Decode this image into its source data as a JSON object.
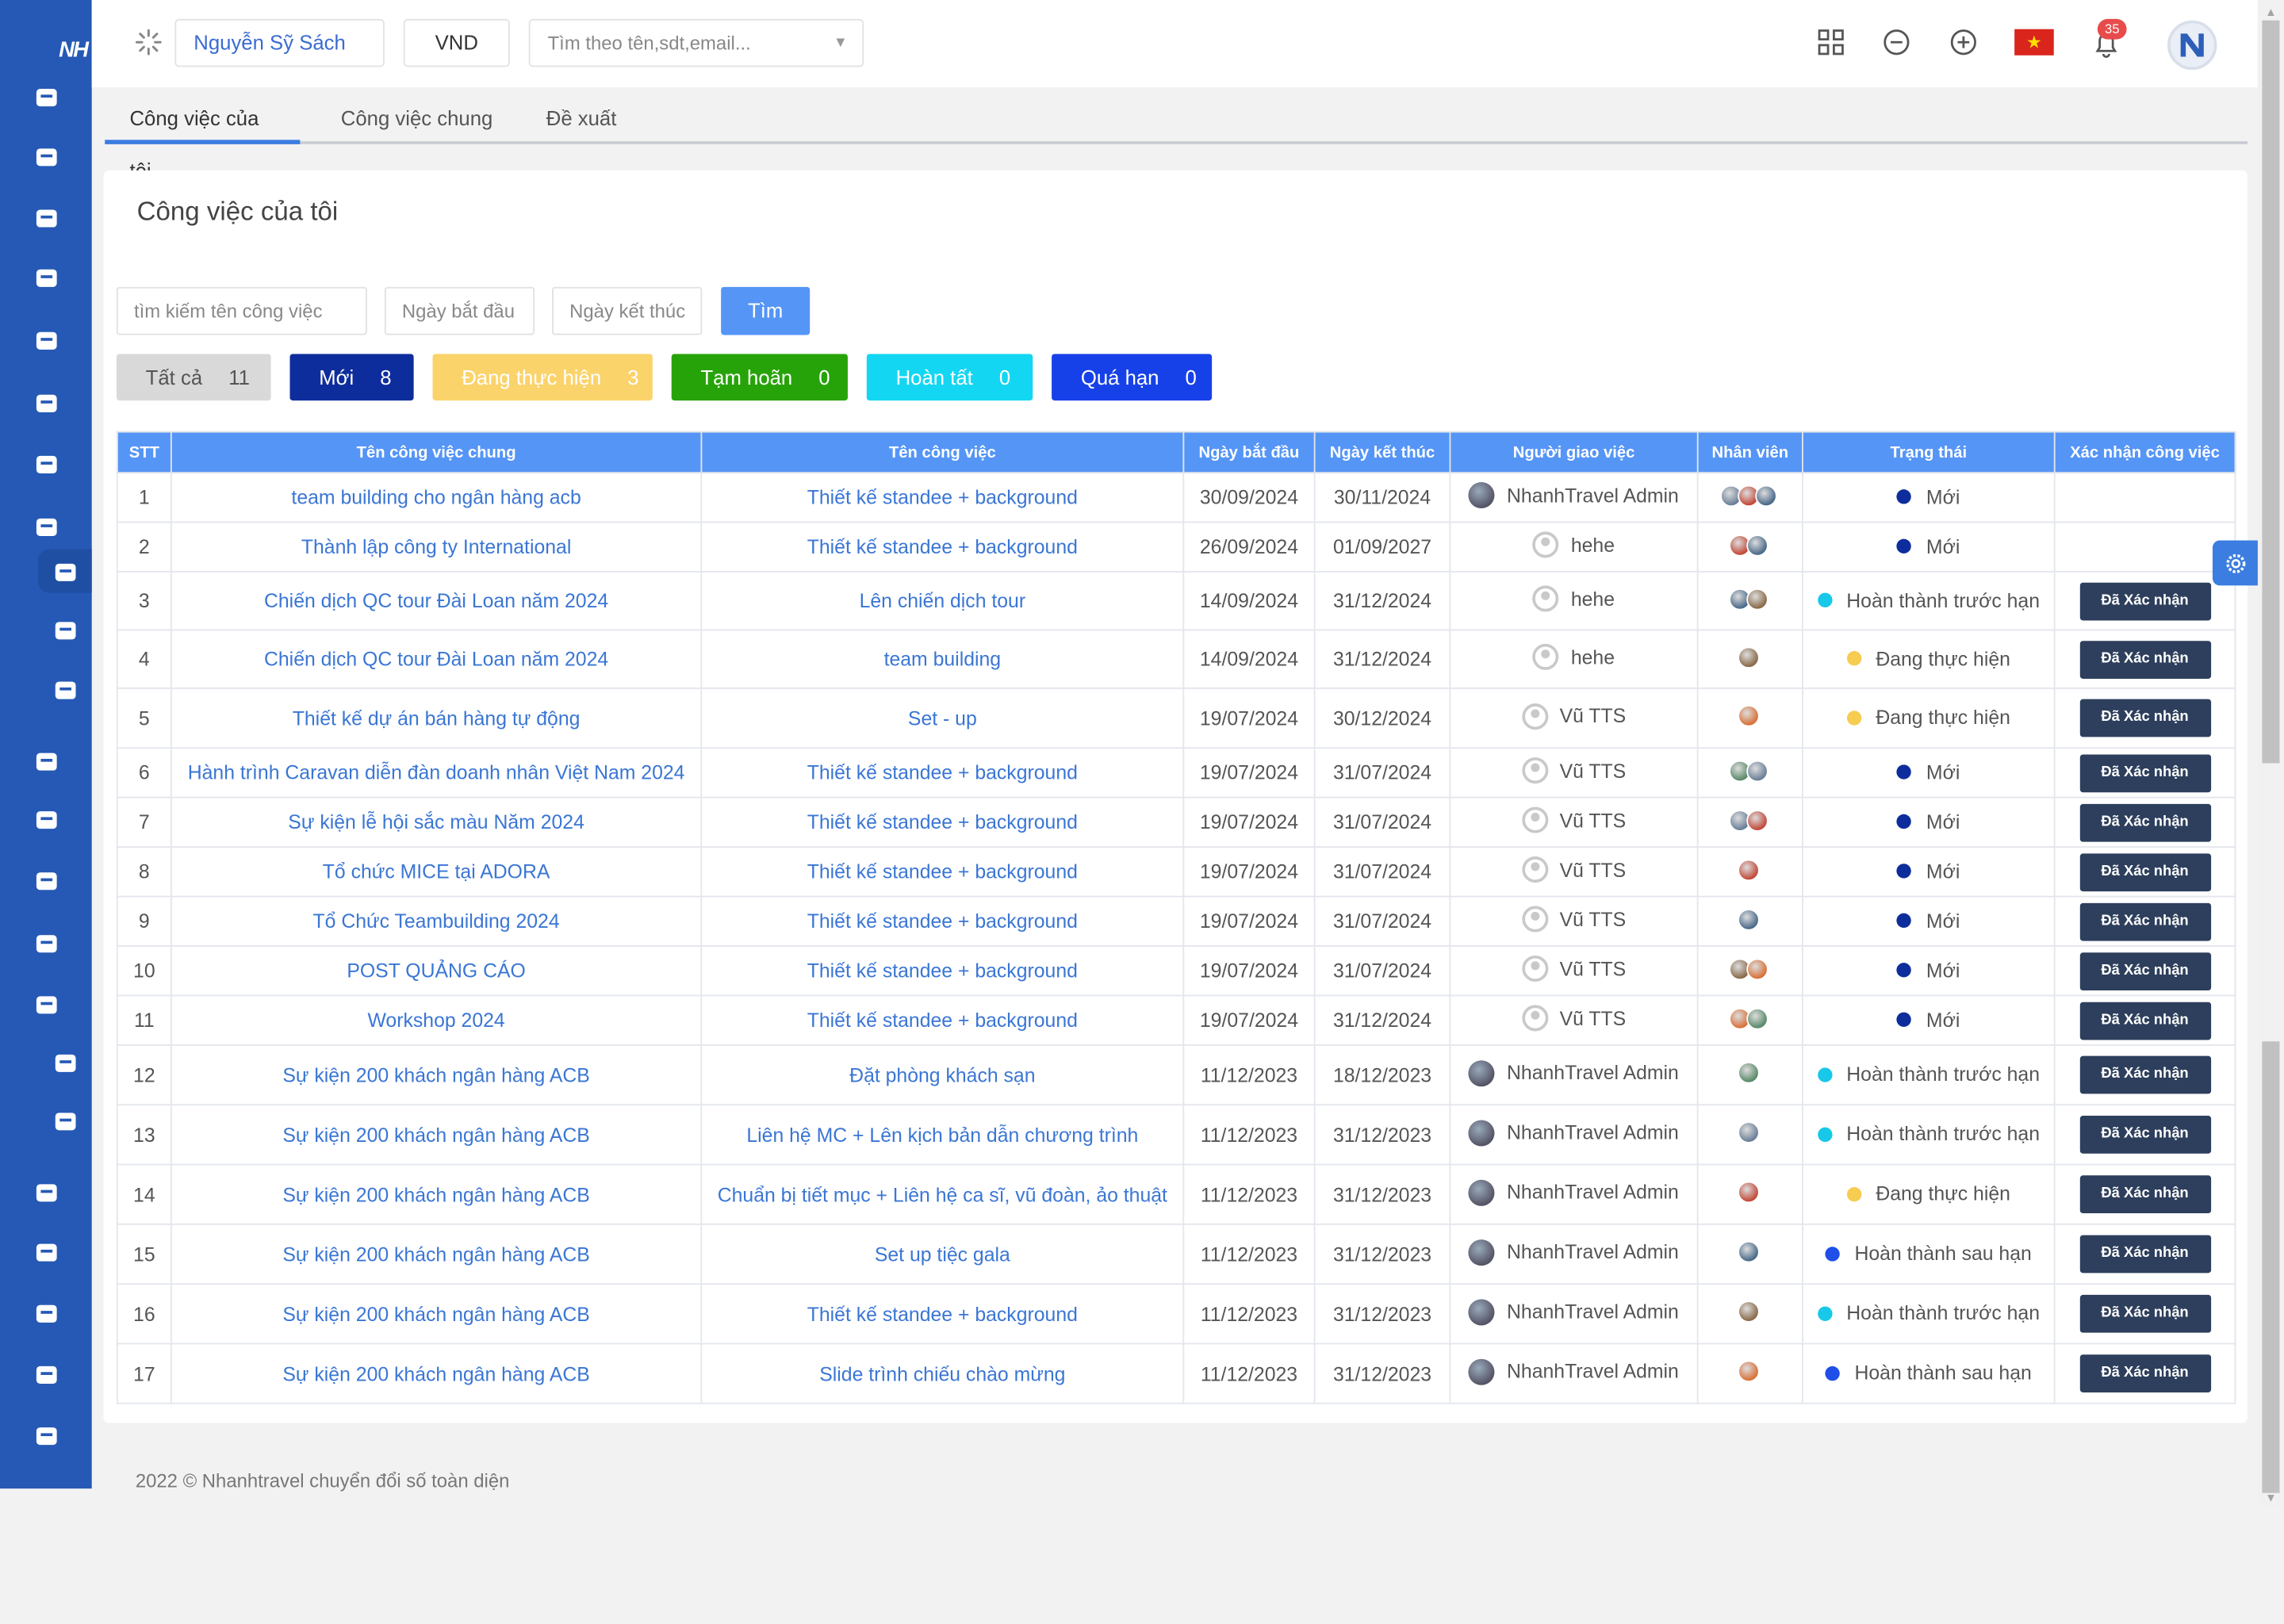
{
  "topbar": {
    "user": "Nguyễn Sỹ Sách",
    "currency": "VND",
    "search_placeholder": "Tìm theo tên,sdt,email...",
    "notification_count": "35"
  },
  "sidebar": {
    "logo": "NH"
  },
  "tabs": [
    "Công việc của tôi",
    "Công việc chung",
    "Đề xuất"
  ],
  "page": {
    "title": "Công việc của tôi",
    "filters": {
      "task_name": "tìm kiếm tên công việc",
      "start_date": "Ngày bắt đầu",
      "end_date": "Ngày kết thúc",
      "find": "Tìm"
    },
    "status_pills": [
      {
        "label": "Tất cả",
        "count": "11"
      },
      {
        "label": "Mới",
        "count": "8"
      },
      {
        "label": "Đang thực hiện",
        "count": "3"
      },
      {
        "label": "Tạm hoãn",
        "count": "0"
      },
      {
        "label": "Hoàn tất",
        "count": "0"
      },
      {
        "label": "Quá hạn",
        "count": "0"
      }
    ]
  },
  "table": {
    "headers": [
      "STT",
      "Tên công việc chung",
      "Tên công việc",
      "Ngày bắt đầu",
      "Ngày kết thúc",
      "Người giao việc",
      "Nhân viên",
      "Trạng thái",
      "Xác nhận công việc"
    ],
    "confirm_label": "Đã Xác nhận",
    "rows": [
      {
        "stt": "1",
        "general": "team building cho ngân hàng acb",
        "task": "Thiết kế standee + background",
        "start": "30/09/2024",
        "end": "30/11/2024",
        "assigner": "NhanhTravel Admin",
        "status": "Mới",
        "confirm": false
      },
      {
        "stt": "2",
        "general": "Thành lập công ty International",
        "task": "Thiết kế standee + background",
        "start": "26/09/2024",
        "end": "01/09/2027",
        "assigner": "hehe",
        "status": "Mới",
        "confirm": false
      },
      {
        "stt": "3",
        "general": "Chiến dịch QC tour Đài Loan năm 2024",
        "task": "Lên chiến dịch tour",
        "start": "14/09/2024",
        "end": "31/12/2024",
        "assigner": "hehe",
        "status": "Hoàn thành trước hạn",
        "confirm": true
      },
      {
        "stt": "4",
        "general": "Chiến dịch QC tour Đài Loan năm 2024",
        "task": "team building",
        "start": "14/09/2024",
        "end": "31/12/2024",
        "assigner": "hehe",
        "status": "Đang thực hiện",
        "confirm": true
      },
      {
        "stt": "5",
        "general": "Thiết kế dự án bán hàng tự động",
        "task": "Set - up",
        "start": "19/07/2024",
        "end": "30/12/2024",
        "assigner": "Vũ TTS",
        "status": "Đang thực hiện",
        "confirm": true
      },
      {
        "stt": "6",
        "general": "Hành trình Caravan diễn đàn doanh nhân Việt Nam 2024",
        "task": "Thiết kế standee + background",
        "start": "19/07/2024",
        "end": "31/07/2024",
        "assigner": "Vũ TTS",
        "status": "Mới",
        "confirm": true
      },
      {
        "stt": "7",
        "general": "Sự kiện lễ hội sắc màu Năm 2024",
        "task": "Thiết kế standee + background",
        "start": "19/07/2024",
        "end": "31/07/2024",
        "assigner": "Vũ TTS",
        "status": "Mới",
        "confirm": true
      },
      {
        "stt": "8",
        "general": "Tổ chức MICE tại ADORA",
        "task": "Thiết kế standee + background",
        "start": "19/07/2024",
        "end": "31/07/2024",
        "assigner": "Vũ TTS",
        "status": "Mới",
        "confirm": true
      },
      {
        "stt": "9",
        "general": "Tổ Chức Teambuilding 2024",
        "task": "Thiết kế standee + background",
        "start": "19/07/2024",
        "end": "31/07/2024",
        "assigner": "Vũ TTS",
        "status": "Mới",
        "confirm": true
      },
      {
        "stt": "10",
        "general": "POST QUẢNG CÁO",
        "task": "Thiết kế standee + background",
        "start": "19/07/2024",
        "end": "31/07/2024",
        "assigner": "Vũ TTS",
        "status": "Mới",
        "confirm": true
      },
      {
        "stt": "11",
        "general": "Workshop 2024",
        "task": "Thiết kế standee + background",
        "start": "19/07/2024",
        "end": "31/12/2024",
        "assigner": "Vũ TTS",
        "status": "Mới",
        "confirm": true
      },
      {
        "stt": "12",
        "general": "Sự kiện 200 khách ngân hàng ACB",
        "task": "Đặt phòng khách sạn",
        "start": "11/12/2023",
        "end": "18/12/2023",
        "assigner": "NhanhTravel Admin",
        "status": "Hoàn thành trước hạn",
        "confirm": true
      },
      {
        "stt": "13",
        "general": "Sự kiện 200 khách ngân hàng ACB",
        "task": "Liên hệ MC + Lên kịch bản dẫn chương trình",
        "start": "11/12/2023",
        "end": "31/12/2023",
        "assigner": "NhanhTravel Admin",
        "status": "Hoàn thành trước hạn",
        "confirm": true
      },
      {
        "stt": "14",
        "general": "Sự kiện 200 khách ngân hàng ACB",
        "task": "Chuẩn bị tiết mục + Liên hệ ca sĩ, vũ đoàn, ảo thuật",
        "start": "11/12/2023",
        "end": "31/12/2023",
        "assigner": "NhanhTravel Admin",
        "status": "Đang thực hiện",
        "confirm": true
      },
      {
        "stt": "15",
        "general": "Sự kiện 200 khách ngân hàng ACB",
        "task": "Set up tiệc gala",
        "start": "11/12/2023",
        "end": "31/12/2023",
        "assigner": "NhanhTravel Admin",
        "status": "Hoàn thành sau hạn",
        "confirm": true
      },
      {
        "stt": "16",
        "general": "Sự kiện 200 khách ngân hàng ACB",
        "task": "Thiết kế standee + background",
        "start": "11/12/2023",
        "end": "31/12/2023",
        "assigner": "NhanhTravel Admin",
        "status": "Hoàn thành trước hạn",
        "confirm": true
      },
      {
        "stt": "17",
        "general": "Sự kiện 200 khách ngân hàng ACB",
        "task": "Slide trình chiếu chào mừng",
        "start": "11/12/2023",
        "end": "31/12/2023",
        "assigner": "NhanhTravel Admin",
        "status": "Hoàn thành sau hạn",
        "confirm": true
      }
    ]
  },
  "status_colors": {
    "Mới": "#0e2d9c",
    "Hoàn thành trước hạn": "#17c8e8",
    "Đang thực hiện": "#f6cc51",
    "Hoàn thành sau hạn": "#1f4ee8"
  },
  "footer": "2022 © Nhanhtravel chuyển đổi số toàn diện"
}
